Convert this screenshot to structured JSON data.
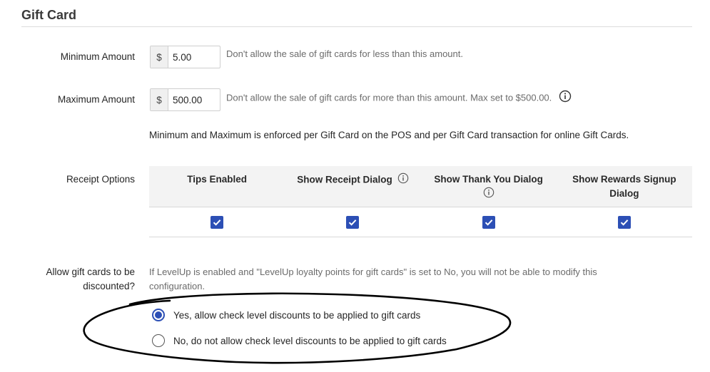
{
  "section": {
    "title": "Gift Card"
  },
  "minimum": {
    "label": "Minimum Amount",
    "currency": "$",
    "value": "5.00",
    "help": "Don't allow the sale of gift cards for less than this amount."
  },
  "maximum": {
    "label": "Maximum Amount",
    "currency": "$",
    "value": "500.00",
    "help": "Don't allow the sale of gift cards for more than this amount. Max set to $500.00."
  },
  "enforcement_note": "Minimum and Maximum is enforced per Gift Card on the POS and per Gift Card transaction for online Gift Cards.",
  "receipt_options": {
    "label": "Receipt Options",
    "columns": [
      {
        "header_line1": "Tips Enabled",
        "header_line2": "",
        "checked": true
      },
      {
        "header_line1": "Show Receipt Dialog",
        "header_line2": "",
        "checked": true
      },
      {
        "header_line1": "Show Thank You Dialog",
        "header_line2": "",
        "checked": true
      },
      {
        "header_line1": "Show Rewards Signup",
        "header_line2": "Dialog",
        "checked": true
      }
    ]
  },
  "discount": {
    "label_line1": "Allow gift cards to be",
    "label_line2": "discounted?",
    "description_line1": "If LevelUp is enabled and \"LevelUp loyalty points for gift cards\" is set to No, you will not be able to modify this",
    "description_line2": "configuration.",
    "options": [
      {
        "label": "Yes, allow check level discounts to be applied to gift cards",
        "selected": true
      },
      {
        "label": "No, do not allow check level discounts to be applied to gift cards",
        "selected": false
      }
    ]
  },
  "colors": {
    "accent": "#2c4fb5",
    "annotation": "#000000"
  }
}
